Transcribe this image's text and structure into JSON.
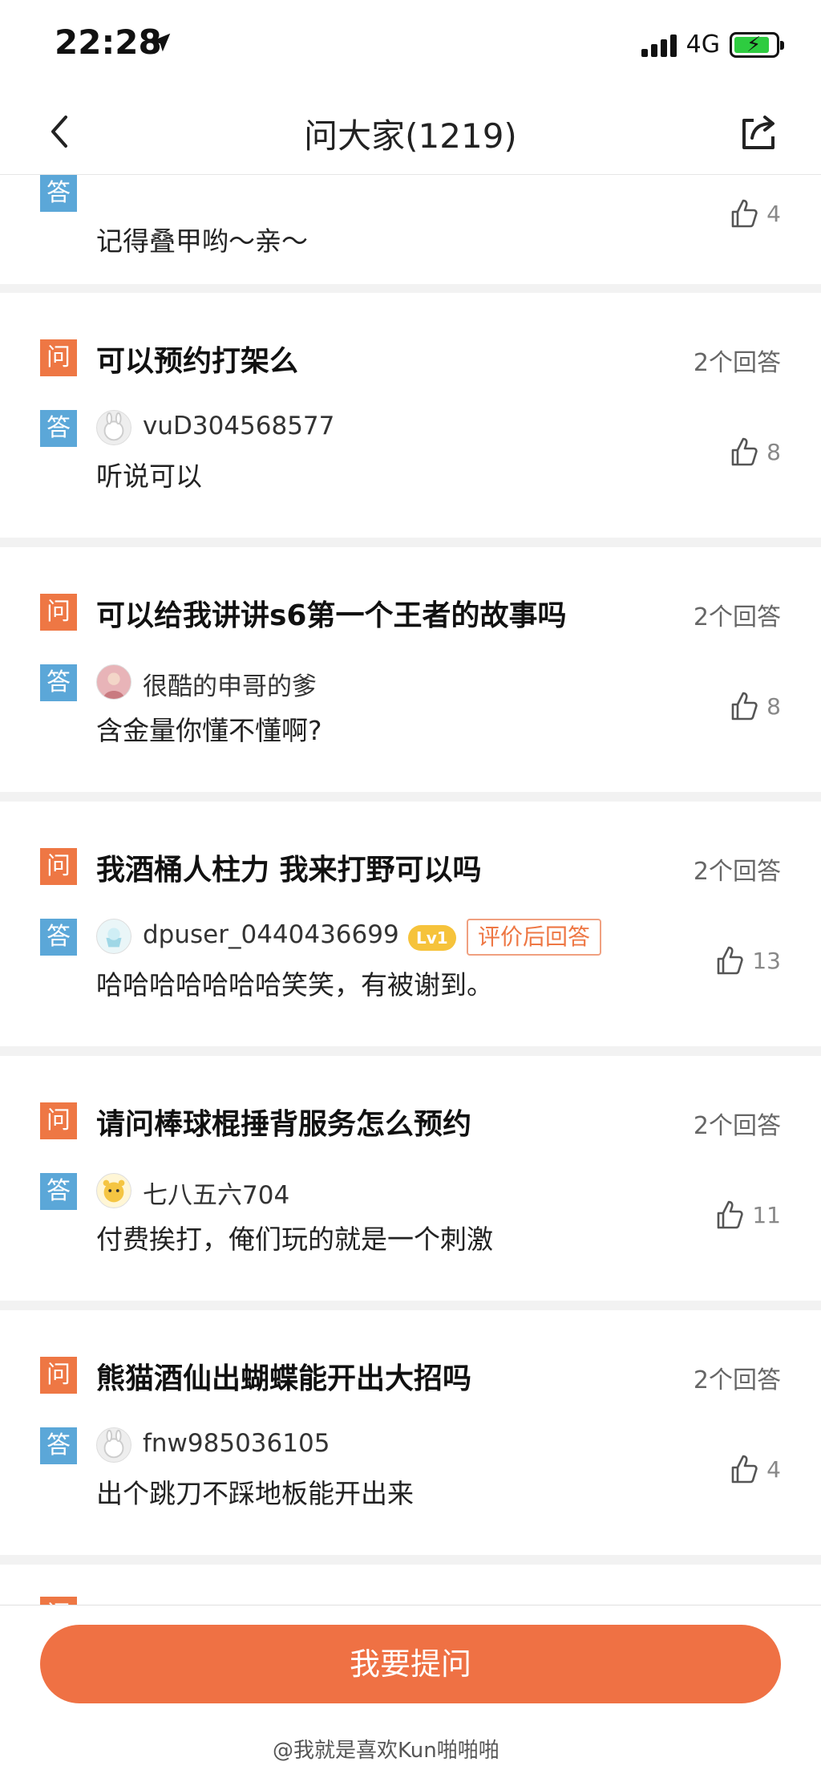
{
  "status": {
    "time": "22:28",
    "network": "4G",
    "battery_level": 0.85
  },
  "nav": {
    "title": "问大家(1219)",
    "back_icon": "chevron-left-icon",
    "share_icon": "share-icon"
  },
  "colors": {
    "accent": "#ef7144",
    "question_tag": "#ee7744",
    "answer_tag": "#5ba7d8",
    "level_badge": "#f6c33b"
  },
  "labels": {
    "question_tag": "问",
    "answer_tag": "答"
  },
  "first_card": {
    "answer_text": "记得叠甲哟～亲～",
    "likes": "4"
  },
  "questions": [
    {
      "question": "可以预约打架么",
      "answer_count": "2个回答",
      "username": "vuD304568577",
      "answer": "听说可以",
      "likes": "8"
    },
    {
      "question": "可以给我讲讲s6第一个王者的故事吗",
      "answer_count": "2个回答",
      "username": "很酷的申哥的爹",
      "answer": "含金量你懂不懂啊?",
      "likes": "8"
    },
    {
      "question": "我酒桶人柱力 我来打野可以吗",
      "answer_count": "2个回答",
      "username": "dpuser_0440436699",
      "level": "Lv1",
      "badge": "评价后回答",
      "answer": "哈哈哈哈哈哈哈笑笑，有被谢到。",
      "likes": "13"
    },
    {
      "question": "请问棒球棍捶背服务怎么预约",
      "answer_count": "2个回答",
      "username": "七八五六704",
      "answer": "付费挨打，俺们玩的就是一个刺激",
      "likes": "11"
    },
    {
      "question": "熊猫酒仙出蝴蝶能开出大招吗",
      "answer_count": "2个回答",
      "username": "fnw985036105",
      "answer": "出个跳刀不踩地板能开出来",
      "likes": "4"
    }
  ],
  "bottom": {
    "ask_button": "我要提问",
    "watermark": "@我就是喜欢Kun啪啪啪"
  }
}
